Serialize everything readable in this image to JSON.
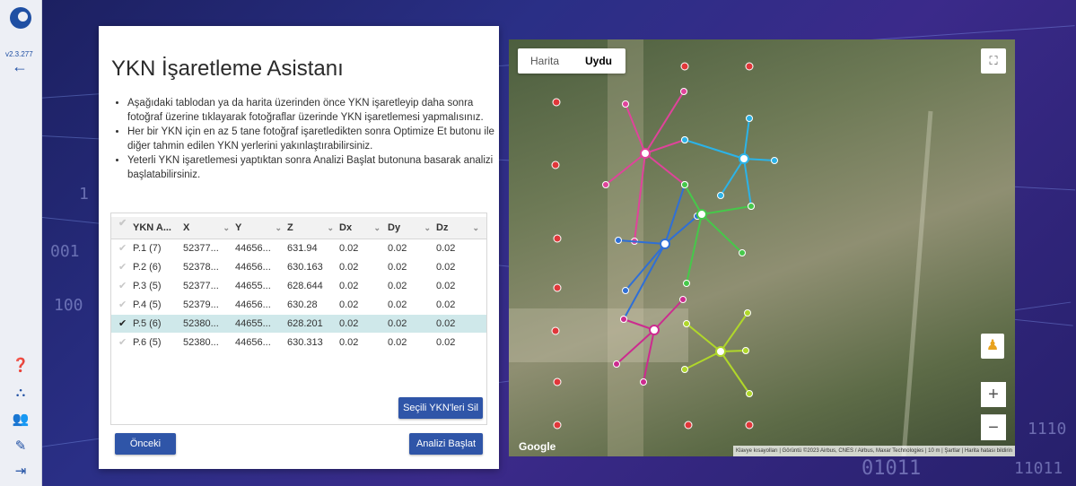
{
  "sidebar": {
    "version": "v2.3.277"
  },
  "panel": {
    "title": "YKN İşaretleme Asistanı",
    "instructions": [
      "Aşağıdaki tablodan ya da harita üzerinden önce YKN işaretleyip daha sonra fotoğraf üzerine tıklayarak fotoğraflar üzerinde YKN işaretlemesi yapmalısınız.",
      "Her bir YKN için en az 5 tane fotoğraf işaretledikten sonra Optimize Et butonu ile diğer tahmin edilen YKN yerlerini yakınlaştırabilirsiniz.",
      "Yeterli YKN işaretlemesi yaptıktan sonra Analizi Başlat butonuna basarak analizi başlatabilirsiniz."
    ],
    "table": {
      "columns": [
        "YKN A...",
        "X",
        "Y",
        "Z",
        "Dx",
        "Dy",
        "Dz"
      ],
      "rows": [
        {
          "name": "P.1 (7)",
          "x": "52377...",
          "y": "44656...",
          "z": "631.94",
          "dx": "0.02",
          "dy": "0.02",
          "dz": "0.02",
          "selected": false
        },
        {
          "name": "P.2 (6)",
          "x": "52378...",
          "y": "44656...",
          "z": "630.163",
          "dx": "0.02",
          "dy": "0.02",
          "dz": "0.02",
          "selected": false
        },
        {
          "name": "P.3 (5)",
          "x": "52377...",
          "y": "44655...",
          "z": "628.644",
          "dx": "0.02",
          "dy": "0.02",
          "dz": "0.02",
          "selected": false
        },
        {
          "name": "P.4 (5)",
          "x": "52379...",
          "y": "44656...",
          "z": "630.28",
          "dx": "0.02",
          "dy": "0.02",
          "dz": "0.02",
          "selected": false
        },
        {
          "name": "P.5 (6)",
          "x": "52380...",
          "y": "44655...",
          "z": "628.201",
          "dx": "0.02",
          "dy": "0.02",
          "dz": "0.02",
          "selected": true
        },
        {
          "name": "P.6 (5)",
          "x": "52380...",
          "y": "44656...",
          "z": "630.313",
          "dx": "0.02",
          "dy": "0.02",
          "dz": "0.02",
          "selected": false
        }
      ]
    },
    "buttons": {
      "delete_selected": "Seçili YKN'leri Sil",
      "previous": "Önceki",
      "start_analysis": "Analizi Başlat"
    }
  },
  "map": {
    "tabs": [
      "Harita",
      "Uydu"
    ],
    "active_tab": "Uydu",
    "google_label": "Google",
    "attribution": "Klavye kısayolları | Görüntü ©2023 Airbus, CNES / Airbus, Maxar Technologies | 10 m | Şartlar | Harita hatası bildirin",
    "zoom_in": "+",
    "zoom_out": "−",
    "series_colors": [
      "#e0439b",
      "#2bb3e8",
      "#2f6fd6",
      "#46c84a",
      "#b0d72a",
      "#cc2b8f"
    ]
  },
  "background": {
    "digits": [
      "1",
      "001",
      "100",
      "01011",
      "111",
      "1110",
      "11011"
    ]
  }
}
